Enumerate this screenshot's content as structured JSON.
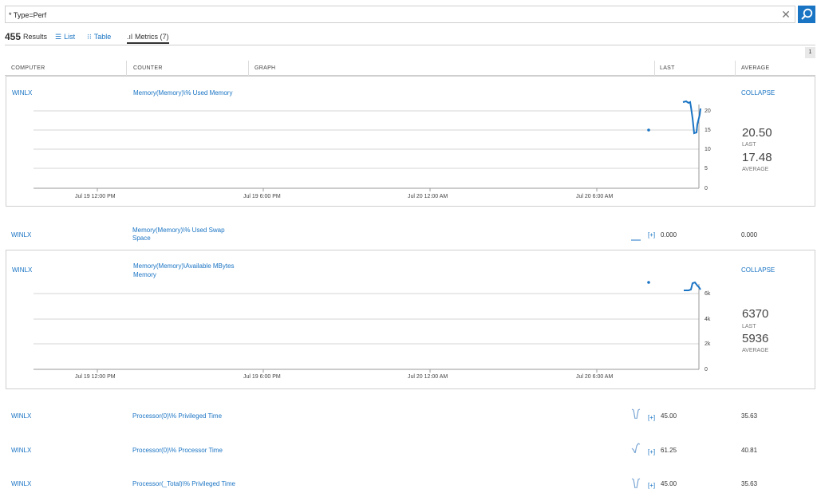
{
  "search": {
    "value": "* Type=Perf"
  },
  "results": {
    "count": "455",
    "label": "Results",
    "tabs": {
      "list": "List",
      "table": "Table",
      "metrics": "Metrics (7)"
    }
  },
  "page_indicator": "1",
  "columns": {
    "computer": "COMPUTER",
    "counter": "COUNTER",
    "graph": "GRAPH",
    "last": "LAST",
    "average": "AVERAGE"
  },
  "rows": [
    {
      "computer": "WINLX",
      "counter_line1": "Memory(Memory)\\% Used Memory",
      "counter_line2": "",
      "toggle": "COLLAPSE",
      "last_value": "20.50",
      "last_label": "LAST",
      "average_value": "17.48",
      "average_label": "AVERAGE",
      "y_ticks": [
        "20",
        "15",
        "10",
        "5",
        "0"
      ],
      "x_ticks": [
        "Jul 19 12:00 PM",
        "Jul 19 6:00 PM",
        "Jul 20 12:00 AM",
        "Jul 20 6:00 AM"
      ]
    },
    {
      "computer": "WINLX",
      "counter_line1": "Memory(Memory)\\% Used Swap",
      "counter_line2": "Space",
      "plus": "[+]",
      "last": "0.000",
      "average": "0.000"
    },
    {
      "computer": "WINLX",
      "counter_line1": "Memory(Memory)\\Available MBytes",
      "counter_line2": "Memory",
      "toggle": "COLLAPSE",
      "last_value": "6370",
      "last_label": "LAST",
      "average_value": "5936",
      "average_label": "AVERAGE",
      "y_ticks": [
        "6k",
        "4k",
        "2k",
        "0"
      ],
      "x_ticks": [
        "Jul 19 12:00 PM",
        "Jul 19 6:00 PM",
        "Jul 20 12:00 AM",
        "Jul 20 6:00 AM"
      ]
    },
    {
      "computer": "WINLX",
      "counter": "Processor(0)\\% Privileged Time",
      "plus": "[+]",
      "last": "45.00",
      "average": "35.63"
    },
    {
      "computer": "WINLX",
      "counter": "Processor(0)\\% Processor Time",
      "plus": "[+]",
      "last": "61.25",
      "average": "40.81"
    },
    {
      "computer": "WINLX",
      "counter": "Processor(_Total)\\% Privileged Time",
      "plus": "[+]",
      "last": "45.00",
      "average": "35.63"
    }
  ],
  "colors": {
    "accent": "#1a74c4",
    "border": "#cfcfcf"
  },
  "icons": {
    "clear": "close-icon",
    "search": "search-icon",
    "list": "list-icon",
    "table": "table-icon",
    "metrics": "metrics-icon"
  }
}
